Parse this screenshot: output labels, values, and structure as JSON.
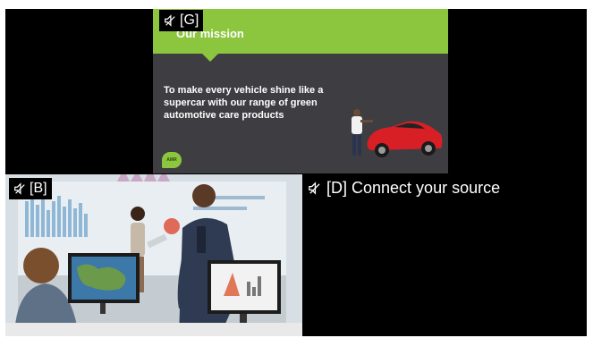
{
  "tiles": {
    "g": {
      "tag": "[G]",
      "slide_title": "Our mission",
      "slide_body": "To make every vehicle shine like a supercar with our range of green automotive care products",
      "logo_text": "AMR"
    },
    "b": {
      "tag": "[B]"
    },
    "d": {
      "tag": "[D]",
      "message": "Connect your source"
    }
  },
  "icons": {
    "speaker": "speaker-muted-icon"
  },
  "colors": {
    "background": "#000000",
    "slide_accent": "#8cc63f",
    "slide_body": "#3d3d42"
  }
}
